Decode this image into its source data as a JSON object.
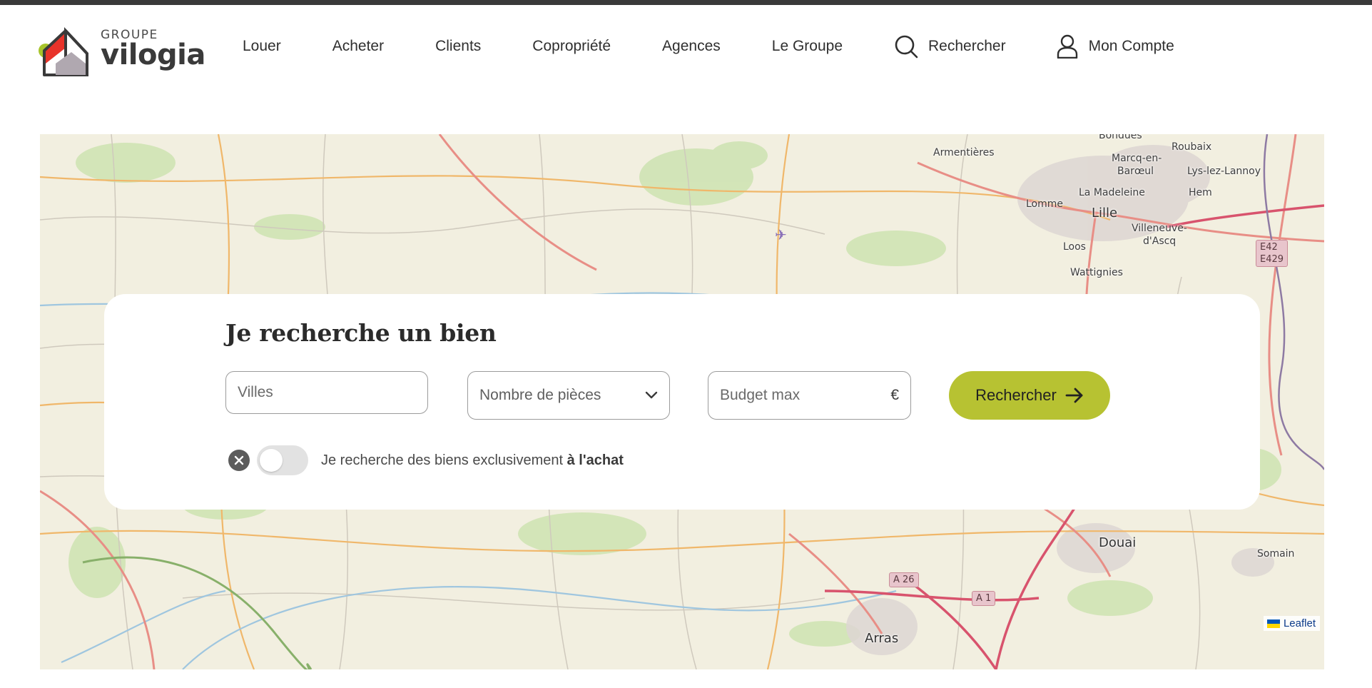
{
  "header": {
    "logo_top": "GROUPE",
    "logo_name": "vilogia",
    "nav": [
      "Louer",
      "Acheter",
      "Clients",
      "Copropriété",
      "Agences",
      "Le Groupe"
    ],
    "search_label": "Rechercher",
    "account_label": "Mon Compte"
  },
  "map": {
    "labels": {
      "bondues": "Bondues",
      "roubaix": "Roubaix",
      "armentieres": "Armentières",
      "marcq": "Marcq-en-",
      "barœul": "Barœul",
      "lys": "Lys-lez-Lannoy",
      "lamadeleine": "La Madeleine",
      "lomme": "Lomme",
      "hem": "Hem",
      "lille": "Lille",
      "villeneuve1": "Villeneuve-",
      "villeneuve2": "d'Ascq",
      "loos": "Loos",
      "wattignies": "Wattignies",
      "douai": "Douai",
      "somain": "Somain",
      "arras": "Arras"
    },
    "shields": {
      "e42": "E42",
      "e429": "E429",
      "a26": "A 26",
      "a1": "A 1"
    },
    "attribution": "Leaflet"
  },
  "search_card": {
    "title": "Je recherche un bien",
    "villes_placeholder": "Villes",
    "pieces_placeholder": "Nombre de pièces",
    "budget_placeholder": "Budget max",
    "currency": "€",
    "button_label": "Rechercher",
    "toggle_text": "Je recherche des biens exclusivement ",
    "toggle_bold": "à l'achat",
    "toggle_on": false
  },
  "colors": {
    "accent": "#b7c232",
    "logo_red": "#e8332a",
    "logo_green": "#a7c42a",
    "map_bg": "#f2efe0"
  }
}
